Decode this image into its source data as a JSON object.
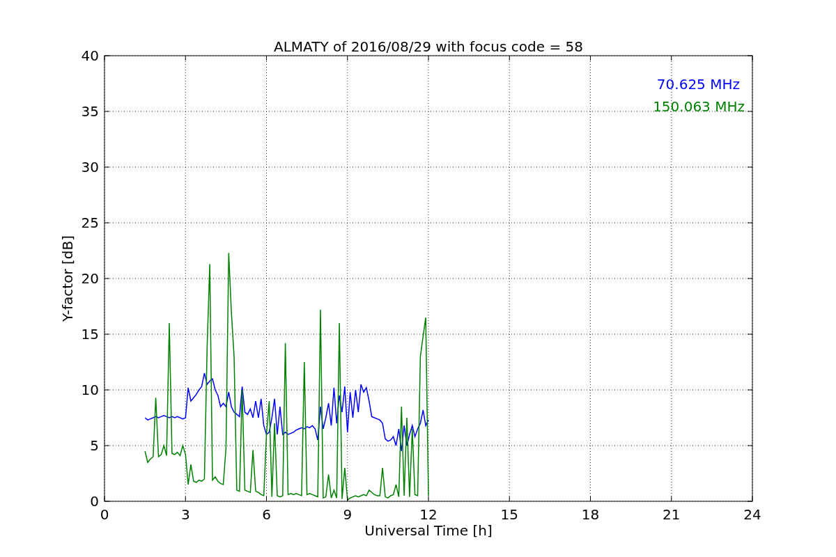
{
  "chart_data": {
    "type": "line",
    "grid": true,
    "title": "ALMATY of 2016/08/29 with focus code = 58",
    "xlabel": "Universal Time [h]",
    "ylabel": "Y-factor [dB]",
    "xlim": [
      0,
      24
    ],
    "ylim": [
      0,
      40
    ],
    "xticks": [
      0,
      3,
      6,
      9,
      12,
      15,
      18,
      21,
      24
    ],
    "yticks": [
      0,
      5,
      10,
      15,
      20,
      25,
      30,
      35,
      40
    ],
    "x": [
      1.5,
      1.6,
      1.7,
      1.8,
      1.9,
      2.0,
      2.1,
      2.2,
      2.3,
      2.4,
      2.5,
      2.6,
      2.7,
      2.8,
      2.9,
      3.0,
      3.1,
      3.2,
      3.3,
      3.4,
      3.5,
      3.6,
      3.7,
      3.8,
      3.9,
      4.0,
      4.1,
      4.2,
      4.3,
      4.4,
      4.5,
      4.6,
      4.7,
      4.8,
      4.9,
      5.0,
      5.1,
      5.2,
      5.3,
      5.4,
      5.5,
      5.6,
      5.7,
      5.8,
      5.9,
      6.0,
      6.1,
      6.2,
      6.3,
      6.4,
      6.5,
      6.6,
      6.7,
      6.8,
      6.9,
      7.0,
      7.1,
      7.2,
      7.3,
      7.4,
      7.5,
      7.6,
      7.7,
      7.8,
      7.9,
      8.0,
      8.1,
      8.2,
      8.3,
      8.4,
      8.5,
      8.6,
      8.7,
      8.8,
      8.9,
      9.0,
      9.1,
      9.2,
      9.3,
      9.4,
      9.5,
      9.6,
      9.7,
      9.8,
      9.9,
      10.0,
      10.1,
      10.2,
      10.3,
      10.4,
      10.5,
      10.6,
      10.7,
      10.8,
      10.9,
      11.0,
      11.1,
      11.2,
      11.3,
      11.4,
      11.5,
      11.6,
      11.7,
      11.8,
      11.9,
      12.0
    ],
    "series": [
      {
        "name": "70.625 MHz",
        "color": "#0000ff",
        "values": [
          7.5,
          7.3,
          7.4,
          7.5,
          7.6,
          7.5,
          7.6,
          7.7,
          7.6,
          7.5,
          7.6,
          7.5,
          7.6,
          7.5,
          7.4,
          7.5,
          10.2,
          9.0,
          9.3,
          9.6,
          10.0,
          10.3,
          11.5,
          10.5,
          10.8,
          11.0,
          10.0,
          9.5,
          8.5,
          8.8,
          8.5,
          9.8,
          8.5,
          8.0,
          7.8,
          7.6,
          10.3,
          8.0,
          7.8,
          8.3,
          7.5,
          9.0,
          7.5,
          9.2,
          6.8,
          6.0,
          6.2,
          7.5,
          9.2,
          6.0,
          8.5,
          6.0,
          6.2,
          6.0,
          6.1,
          6.2,
          6.4,
          6.5,
          6.6,
          6.5,
          6.7,
          6.6,
          6.8,
          6.5,
          5.5,
          8.5,
          6.5,
          7.5,
          8.8,
          6.8,
          10.2,
          7.0,
          9.5,
          8.0,
          10.3,
          6.2,
          9.8,
          7.5,
          10.0,
          8.0,
          10.5,
          9.8,
          10.2,
          9.0,
          7.6,
          7.5,
          7.4,
          7.3,
          7.0,
          5.6,
          5.4,
          5.5,
          5.8,
          5.0,
          6.5,
          4.5,
          6.8,
          5.0,
          6.0,
          6.8,
          5.8,
          6.5,
          7.0,
          8.2,
          6.8,
          7.3
        ]
      },
      {
        "name": "150.063 MHz",
        "color": "#008000",
        "values": [
          4.5,
          3.5,
          3.8,
          4.0,
          9.3,
          4.0,
          4.2,
          5.0,
          4.1,
          16.0,
          4.3,
          4.2,
          4.4,
          4.1,
          5.0,
          4.2,
          1.5,
          3.3,
          1.8,
          1.7,
          1.9,
          1.8,
          2.0,
          13.8,
          21.3,
          1.9,
          2.2,
          1.8,
          1.6,
          1.5,
          4.8,
          22.3,
          17.0,
          13.0,
          1.0,
          0.9,
          10.0,
          1.0,
          0.9,
          0.8,
          4.6,
          0.9,
          0.8,
          0.6,
          0.5,
          6.0,
          9.0,
          0.4,
          7.0,
          0.5,
          0.4,
          0.5,
          14.2,
          0.6,
          0.7,
          0.6,
          0.7,
          0.6,
          0.5,
          12.5,
          0.6,
          0.7,
          0.6,
          0.5,
          0.4,
          17.2,
          0.3,
          0.4,
          2.4,
          0.3,
          1.0,
          0.3,
          16.0,
          0.2,
          3.0,
          0.1,
          0.3,
          0.4,
          0.5,
          0.4,
          0.5,
          0.6,
          0.5,
          1.0,
          0.8,
          0.6,
          0.5,
          0.5,
          3.0,
          0.4,
          0.3,
          0.5,
          0.6,
          1.5,
          0.4,
          8.5,
          0.5,
          7.5,
          0.4,
          6.5,
          0.6,
          0.5,
          13.0,
          14.8,
          16.5,
          0.5
        ]
      }
    ]
  }
}
